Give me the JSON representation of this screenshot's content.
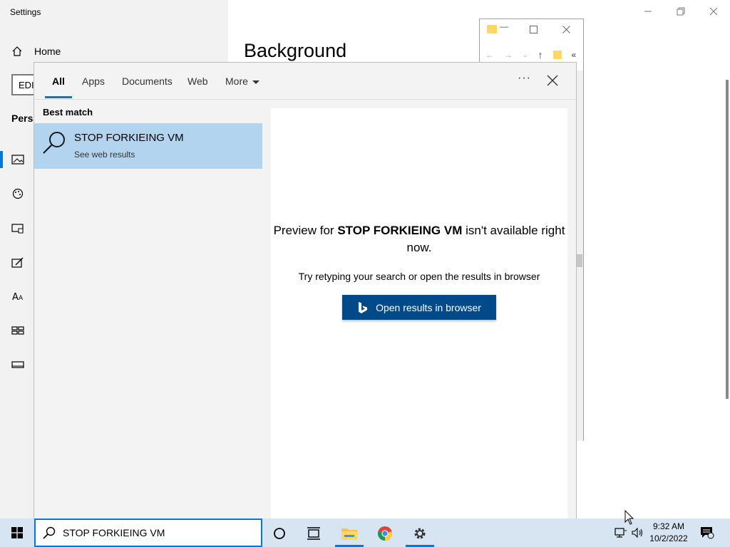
{
  "settings": {
    "title": "Settings",
    "home_label": "Home",
    "search_value": "EDIT",
    "section_label": "Personalization",
    "page_title": "Background"
  },
  "search_panel": {
    "tabs": [
      "All",
      "Apps",
      "Documents",
      "Web",
      "More"
    ],
    "best_match_label": "Best match",
    "best_match": {
      "name": "STOP FORKIEING VM",
      "sub": "See web results"
    },
    "preview": {
      "msg_prefix": "Preview for ",
      "msg_query": "STOP FORKIEING VM",
      "msg_suffix": " isn't available right now.",
      "hint": "Try retyping your search or open the results in browser",
      "button": "Open results in browser"
    }
  },
  "taskbar": {
    "search_value": "STOP FORKIEING VM",
    "time": "9:32 AM",
    "date": "10/2/2022"
  },
  "colors": {
    "accent": "#0078d7",
    "selected_item": "#b3d4ee",
    "button": "#004a89"
  }
}
